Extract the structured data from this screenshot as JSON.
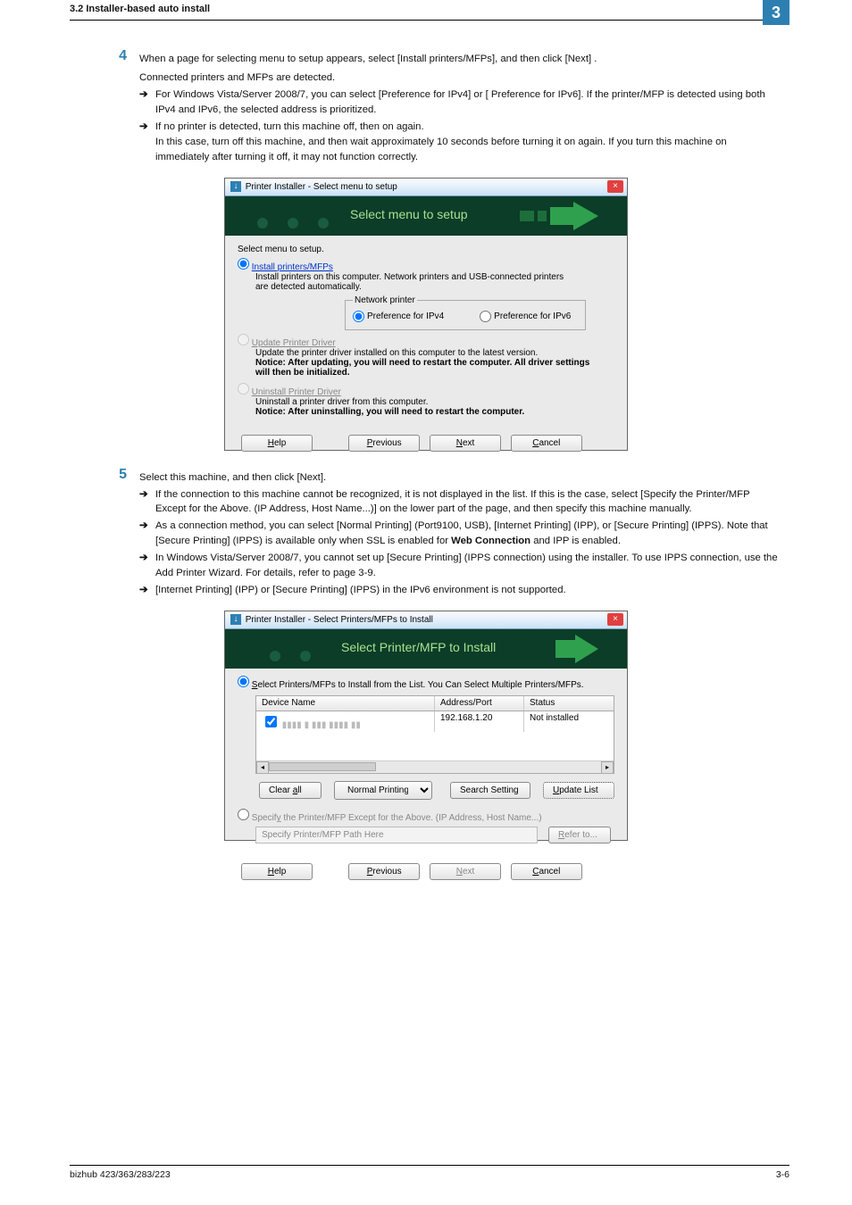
{
  "header": {
    "left": "3.2        Installer-based auto install",
    "num": "3"
  },
  "step4": {
    "num": "4",
    "main": "When a page for selecting menu to setup appears, select [Install printers/MFPs], and then click [Next] .",
    "p2": "Connected printers and MFPs are detected.",
    "a1": "For Windows Vista/Server 2008/7, you can select [Preference for IPv4] or [ Preference for IPv6]. If the printer/MFP is detected using both IPv4 and IPv6, the selected address is prioritized.",
    "a2a": "If no printer is detected, turn this machine off, then on again.",
    "a2b": "In this case, turn off this machine, and then wait approximately 10 seconds before turning it on again. If you turn this machine on immediately after turning it off, it may not function correctly."
  },
  "step5": {
    "num": "5",
    "main": "Select this machine, and then click [Next].",
    "a1": "If the connection to this machine cannot be recognized, it is not displayed in the list. If this is the case, select [Specify the Printer/MFP Except for the Above. (IP Address, Host Name...)] on the lower part of the page, and then specify this machine manually.",
    "a2a": "As a connection method, you can select [Normal Printing] (Port9100, USB), [Internet Printing] (IPP), or [Secure Printing] (IPPS). Note that [Secure Printing] (IPPS)  is available only when SSL is enabled for ",
    "a2bold": "Web Connection",
    "a2b": " and IPP is enabled.",
    "a3": "In Windows Vista/Server 2008/7, you cannot set up [Secure Printing] (IPPS connection) using the installer. To use IPPS connection, use the Add Printer Wizard. For details, refer to page 3-9.",
    "a4": "[Internet Printing] (IPP) or [Secure Printing] (IPPS) in the IPv6 environment is not supported."
  },
  "shot1": {
    "title": "Printer Installer - Select menu to setup",
    "close": "×",
    "banner": "Select menu to setup",
    "heading": "Select menu to setup.",
    "r1_label": "Install printers/MFPs",
    "r1_desc": "Install printers on this computer. Network printers and USB-connected printers are detected automatically.",
    "np_legend": "Network printer",
    "np_ipv4": "Preference for IPv4",
    "np_ipv6": "Preference for IPv6",
    "r2_label": "Update Printer Driver",
    "r2_l1": "Update the printer driver installed on this computer to the latest version.",
    "r2_l2": "Notice: After updating, you will need to restart the computer. All driver settings will then be initialized.",
    "r3_label": "Uninstall Printer Driver",
    "r3_l1": "Uninstall a printer driver from this computer.",
    "r3_l2": "Notice: After uninstalling, you will need to restart the computer.",
    "btn_help": "Help",
    "btn_prev": "Previous",
    "btn_next": "Next",
    "btn_cancel": "Cancel"
  },
  "shot2": {
    "title": "Printer Installer - Select Printers/MFPs to Install",
    "close": "×",
    "banner": "Select Printer/MFP to Install",
    "opt1": "Select Printers/MFPs to Install from the List. You Can Select Multiple Printers/MFPs.",
    "col1": "Device Name",
    "col2": "Address/Port",
    "col3": "Status",
    "row_addr": "192.168.1.20",
    "row_status": "Not installed",
    "btn_clear": "Clear all",
    "dd_normal": "Normal Printing",
    "btn_search": "Search Setting",
    "btn_update": "Update List",
    "opt2": "Specify the Printer/MFP Except for the Above. (IP Address, Host Name...)",
    "path_placeholder": "Specify Printer/MFP Path Here",
    "btn_refer": "Refer to...",
    "btn_help": "Help",
    "btn_prev": "Previous",
    "btn_next": "Next",
    "btn_cancel": "Cancel"
  },
  "footer": {
    "left": "bizhub 423/363/283/223",
    "right": "3-6"
  }
}
